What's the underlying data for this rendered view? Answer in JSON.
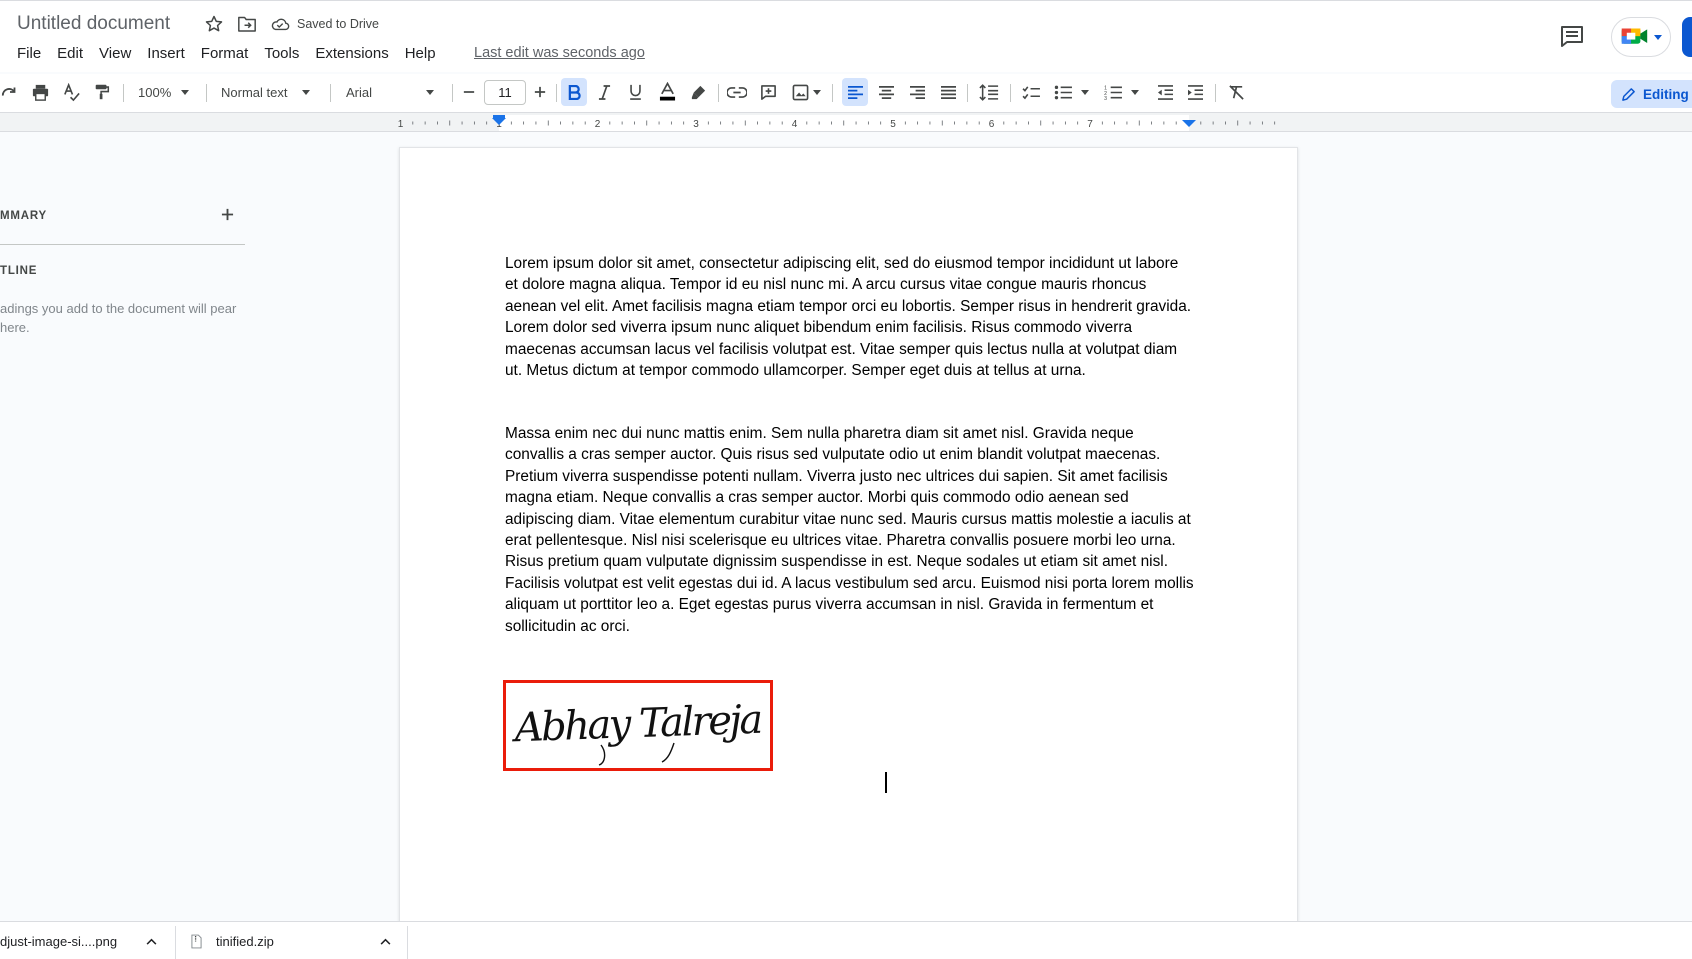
{
  "header": {
    "doc_title": "Untitled document",
    "save_status": "Saved to Drive",
    "last_edit": "Last edit was seconds ago",
    "menu": [
      "File",
      "Edit",
      "View",
      "Insert",
      "Format",
      "Tools",
      "Extensions",
      "Help"
    ],
    "star_icon": "star-outline-icon",
    "move_icon": "folder-move-icon",
    "cloud_icon": "cloud-done-icon",
    "comments_icon": "comment-history-icon",
    "meet_icon": "google-meet-icon"
  },
  "toolbar": {
    "zoom": "100%",
    "style": "Normal text",
    "font": "Arial",
    "font_size": "11",
    "mode": "Editing",
    "text_color": "#000000",
    "active_button_color": "#d3e3fd"
  },
  "ruler": {
    "numbers": [
      "1",
      "1",
      "2",
      "3",
      "4",
      "5",
      "6",
      "7"
    ]
  },
  "sidebar": {
    "summary_label": "MMARY",
    "outline_label": "TLINE",
    "outline_hint": "adings you add to the document will pear here.",
    "add_icon": "plus-icon"
  },
  "document": {
    "paragraphs": [
      "Lorem ipsum dolor sit amet, consectetur adipiscing elit, sed do eiusmod tempor incididunt ut labore et dolore magna aliqua. Tempor id eu nisl nunc mi. A arcu cursus vitae congue mauris rhoncus aenean vel elit. Amet facilisis magna etiam tempor orci eu lobortis. Semper risus in hendrerit gravida. Lorem dolor sed viverra ipsum nunc aliquet bibendum enim facilisis. Risus commodo viverra maecenas accumsan lacus vel facilisis volutpat est. Vitae semper quis lectus nulla at volutpat diam ut. Metus dictum at tempor commodo ullamcorper. Semper eget duis at tellus at urna.",
      "Massa enim nec dui nunc mattis enim. Sem nulla pharetra diam sit amet nisl. Gravida neque convallis a cras semper auctor. Quis risus sed vulputate odio ut enim blandit volutpat maecenas. Pretium viverra suspendisse potenti nullam. Viverra justo nec ultrices dui sapien. Sit amet facilisis magna etiam. Neque convallis a cras semper auctor. Morbi quis commodo odio aenean sed adipiscing diam. Vitae elementum curabitur vitae nunc sed. Mauris cursus mattis molestie a iaculis at erat pellentesque. Nisl nisi scelerisque eu ultrices vitae. Pharetra convallis posuere morbi leo urna. Risus pretium quam vulputate dignissim suspendisse in est. Neque sodales ut etiam sit amet nisl. Facilisis volutpat est velit egestas dui id. A lacus vestibulum sed arcu. Euismod nisi porta lorem mollis aliquam ut porttitor leo a. Eget egestas purus viverra accumsan in nisl. Gravida in fermentum et sollicitudin ac orci."
    ],
    "signature": "Abhay Talreja",
    "signature_border_color": "#ea1c0a"
  },
  "downloads": [
    {
      "name": "djust-image-si....png",
      "icon": "image-file-icon"
    },
    {
      "name": "tinified.zip",
      "icon": "zip-file-icon"
    }
  ]
}
